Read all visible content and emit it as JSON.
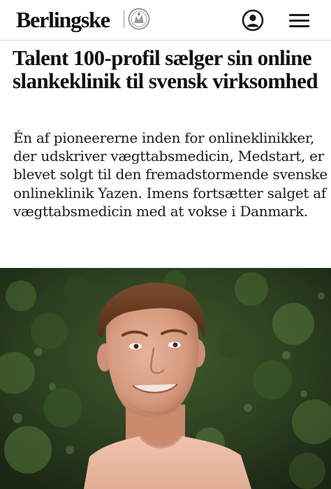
{
  "header": {
    "logo_text": "Berlingske",
    "crest_icon": "berlingske-crest-icon",
    "account_icon": "user-account-icon",
    "menu_icon": "hamburger-menu-icon"
  },
  "article": {
    "headline": "Talent 100-profil sælger sin online slankeklinik til svensk virksomhed",
    "summary": "Én af pioneererne inden for onlineklinikker, der udskriver vægttabsmedicin, Medstart, er blevet solgt til den fremadstormende svenske onlineklinik Yazen. Imens fortsætter salget af vægttabsmedicin med at vokse i Danmark."
  },
  "colors": {
    "text": "#111111",
    "foliage": "#2f4a22",
    "shirt": "#e9b9a3"
  }
}
